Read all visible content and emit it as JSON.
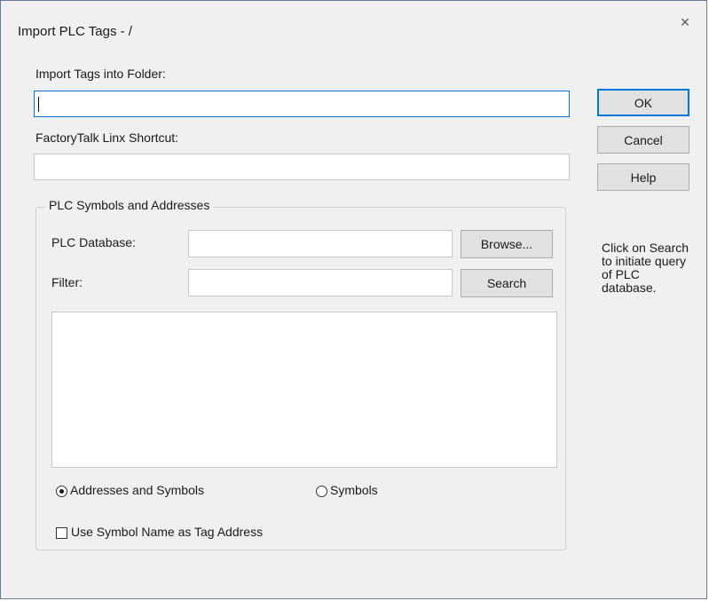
{
  "window": {
    "title": "Import PLC Tags - /",
    "close_symbol": "×"
  },
  "folder": {
    "label": "Import Tags into Folder:",
    "value": ""
  },
  "shortcut": {
    "label": "FactoryTalk Linx Shortcut:",
    "value": ""
  },
  "buttons": {
    "ok": "OK",
    "cancel": "Cancel",
    "help": "Help",
    "browse": "Browse...",
    "search": "Search"
  },
  "group": {
    "title": "PLC Symbols and Addresses",
    "database_label": "PLC Database:",
    "database_value": "",
    "filter_label": "Filter:",
    "filter_value": "",
    "results": []
  },
  "hint": "Click on Search to initiate query of PLC database.",
  "radios": {
    "addresses_and_symbols": "Addresses and Symbols",
    "symbols": "Symbols",
    "selected": "addresses_and_symbols"
  },
  "checkbox": {
    "label": "Use Symbol Name as Tag Address",
    "checked": false
  },
  "colors": {
    "accent": "#0078d7",
    "dialog_bg": "#f0f0f0",
    "button_bg": "#e1e1e1"
  }
}
